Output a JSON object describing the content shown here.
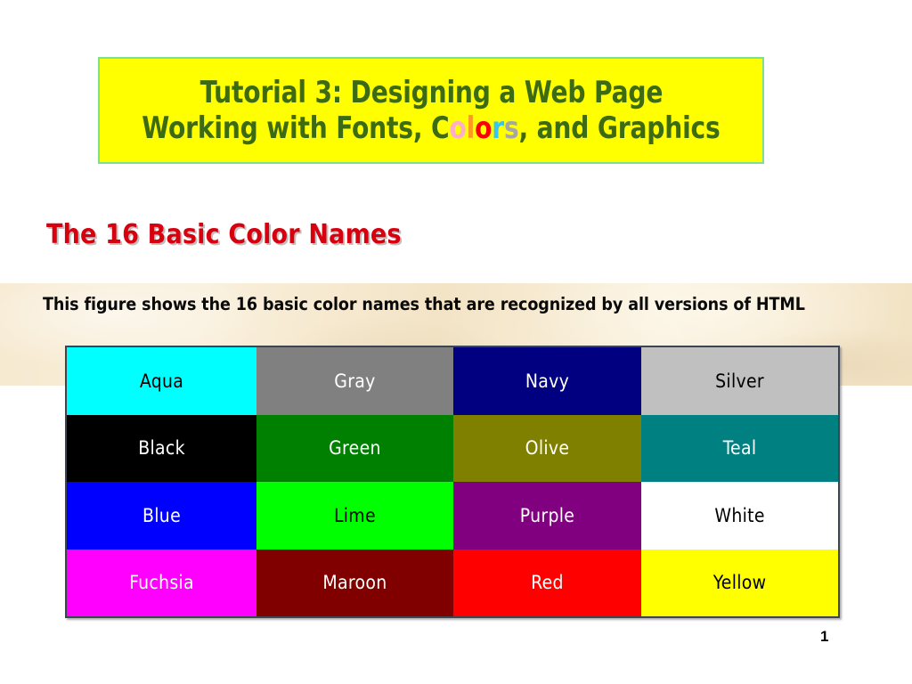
{
  "slide": {
    "page_number": "1",
    "background_color": "#ffffff"
  },
  "title_box": {
    "background_color": "#ffff00",
    "border_color": "#7ee08a",
    "text_color": "#3d6b14",
    "line1": "Tutorial 3: Designing a Web Page",
    "line2_part1": "Working with Fonts, ",
    "line2_colors_letters": [
      {
        "char": "C",
        "color": "#3d6b14"
      },
      {
        "char": "o",
        "color": "#ffaec9"
      },
      {
        "char": "l",
        "color": "#ff9a1f"
      },
      {
        "char": "o",
        "color": "#fb0007"
      },
      {
        "char": "r",
        "color": "#35c6f4"
      },
      {
        "char": "s",
        "color": "#a6a6a6"
      }
    ],
    "line2_part2": ", and Graphics"
  },
  "section_heading": {
    "text": "The 16 Basic Color Names",
    "color": "#d7000f"
  },
  "band": {
    "background_color": "#f5e7cb",
    "text": "This figure shows the 16 basic color names that are recognized by all versions of HTML",
    "text_color": "#0a0a0a"
  },
  "color_grid": {
    "border_color": "#3e4550",
    "rows": 4,
    "columns": 4,
    "swatches": [
      {
        "name": "Aqua",
        "bg": "#00ffff",
        "fg": "#000000"
      },
      {
        "name": "Gray",
        "bg": "#808080",
        "fg": "#ffffff"
      },
      {
        "name": "Navy",
        "bg": "#000080",
        "fg": "#ffffff"
      },
      {
        "name": "Silver",
        "bg": "#c0c0c0",
        "fg": "#000000"
      },
      {
        "name": "Black",
        "bg": "#000000",
        "fg": "#ffffff"
      },
      {
        "name": "Green",
        "bg": "#008000",
        "fg": "#ffffff"
      },
      {
        "name": "Olive",
        "bg": "#808000",
        "fg": "#ffffff"
      },
      {
        "name": "Teal",
        "bg": "#008080",
        "fg": "#ffffff"
      },
      {
        "name": "Blue",
        "bg": "#0000ff",
        "fg": "#ffffff"
      },
      {
        "name": "Lime",
        "bg": "#00ff00",
        "fg": "#000000"
      },
      {
        "name": "Purple",
        "bg": "#800080",
        "fg": "#ffffff"
      },
      {
        "name": "White",
        "bg": "#ffffff",
        "fg": "#000000"
      },
      {
        "name": "Fuchsia",
        "bg": "#ff00ff",
        "fg": "#ffffff"
      },
      {
        "name": "Maroon",
        "bg": "#800000",
        "fg": "#ffffff"
      },
      {
        "name": "Red",
        "bg": "#ff0000",
        "fg": "#ffffff"
      },
      {
        "name": "Yellow",
        "bg": "#ffff00",
        "fg": "#000000"
      }
    ]
  }
}
